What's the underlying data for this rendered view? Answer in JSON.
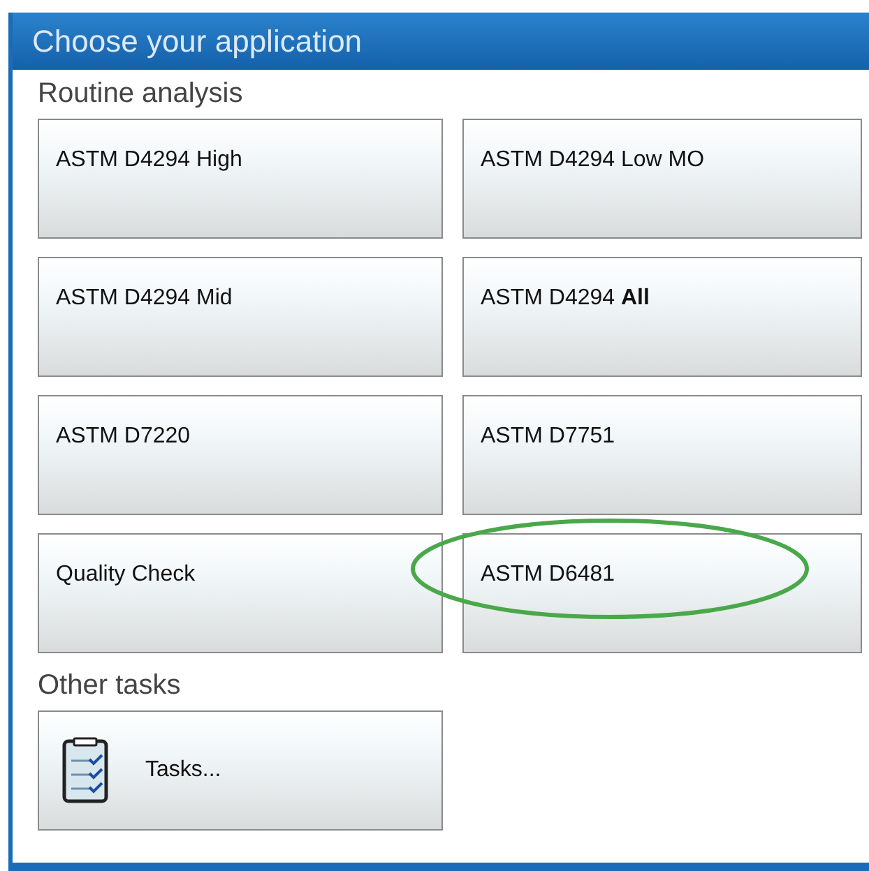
{
  "window": {
    "title": "Choose your application"
  },
  "sections": [
    {
      "heading": "Routine analysis",
      "buttons": [
        {
          "kind": "text",
          "label": "ASTM D4294 High",
          "highlighted": false
        },
        {
          "kind": "text",
          "label": "ASTM D4294 Low MO",
          "highlighted": false
        },
        {
          "kind": "text",
          "label": "ASTM D4294 Mid",
          "highlighted": false
        },
        {
          "kind": "text",
          "label": "ASTM D4294 **All**",
          "highlighted": false
        },
        {
          "kind": "text",
          "label": "ASTM D7220",
          "highlighted": false
        },
        {
          "kind": "text",
          "label": "ASTM D7751",
          "highlighted": false
        },
        {
          "kind": "text",
          "label": "Quality Check",
          "highlighted": false
        },
        {
          "kind": "text",
          "label": "ASTM D6481",
          "highlighted": true
        }
      ]
    },
    {
      "heading": "Other tasks",
      "buttons": [
        {
          "kind": "tasks",
          "label": "Tasks...",
          "highlighted": false
        }
      ]
    }
  ]
}
